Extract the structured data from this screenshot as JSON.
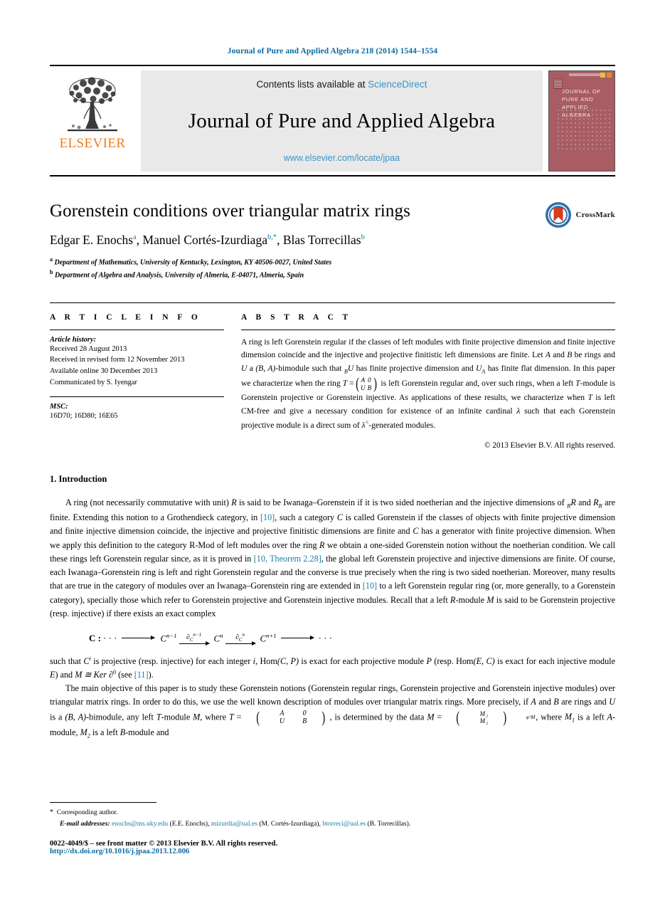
{
  "running_head": "Journal of Pure and Applied Algebra 218 (2014) 1544–1554",
  "masthead": {
    "publisher": "ELSEVIER",
    "contents_prefix": "Contents lists available at ",
    "contents_link": "ScienceDirect",
    "journal_title": "Journal of Pure and Applied Algebra",
    "journal_url": "www.elsevier.com/locate/jpaa",
    "cover_title": "JOURNAL OF PURE AND APPLIED ALGEBRA",
    "link_color": "#3c94c8",
    "cover_color": "#a95c63"
  },
  "article": {
    "title": "Gorenstein conditions over triangular matrix rings",
    "authors": [
      {
        "name": "Edgar E. Enochs",
        "marks": "a"
      },
      {
        "name": "Manuel Cortés-Izurdiaga",
        "marks": "b,*"
      },
      {
        "name": "Blas Torrecillas",
        "marks": "b"
      }
    ],
    "affiliations": [
      {
        "mark": "a",
        "text": "Department of Mathematics, University of Kentucky, Lexington, KY 40506-0027, United States"
      },
      {
        "mark": "b",
        "text": "Department of Algebra and Analysis, University of Almeria, E-04071, Almeria, Spain"
      }
    ],
    "crossmark_label": "CrossMark"
  },
  "info": {
    "heading": "A R T I C L E  I N F O",
    "history_title": "Article history:",
    "history": [
      "Received 28 August 2013",
      "Received in revised form 12 November 2013",
      "Available online 30 December 2013",
      "Communicated by S. Iyengar"
    ],
    "msc_title": "MSC:",
    "msc_codes": "16D70; 16D80; 16E65"
  },
  "abstract": {
    "heading": "A B S T R A C T",
    "p1": "A ring is left Gorenstein regular if the classes of left modules with finite projective dimension and finite injective dimension coincide and the injective and projective finitistic left dimensions are finite. Let ",
    "p2": " and ",
    "p3": " be rings and ",
    "p4": " a ",
    "p5": "-bimodule such that ",
    "p6": " has finite projective dimension and ",
    "p7": " has finite flat dimension. In this paper we characterize when the ring ",
    "p8": " is left Gorenstein regular and, over such rings, when a left ",
    "p9": "-module is Gorenstein projective or Gorenstein injective. As applications of these results, we characterize when ",
    "p10": " is left CM-free and give a necessary condition for existence of an infinite cardinal ",
    "p11": " such that each Gorenstein projective module is a direct sum of ",
    "p12": "-generated modules.",
    "var_A": "A",
    "var_B": "B",
    "var_U": "U",
    "bimod": "(B, A)",
    "sub_BU": "U",
    "sub_B": "B",
    "U_A": "U",
    "sub_A": "A",
    "var_T": "T",
    "lambda": "λ",
    "lambda_sup": "<",
    "matrix": {
      "r1c1": "A",
      "r1c2": "0",
      "r2c1": "U",
      "r2c2": "B"
    },
    "copyright": "© 2013 Elsevier B.V. All rights reserved."
  },
  "intro": {
    "heading": "1. Introduction",
    "para1_a": "A ring (not necessarily commutative with unit) ",
    "para1_b": " is said to be Iwanaga–Gorenstein if it is two sided noetherian and the injective dimensions of ",
    "para1_c": " and ",
    "para1_d": " are finite. Extending this notion to a Grothendieck category, in ",
    "ref10": "[10]",
    "para1_e": ", such a category ",
    "para1_f": " is called Gorenstein if the classes of objects with finite projective dimension and finite injective dimension coincide, the injective and projective finitistic dimensions are finite and ",
    "para1_g": " has a generator with finite projective dimension. When we apply this definition to the category R-Mod of left modules over the ring ",
    "para1_h": " we obtain a one-sided Gorenstein notion without the noetherian condition. We call these rings left Gorenstein regular since, as it is proved in ",
    "ref10thm": "[10, Theorem 2.28]",
    "para1_i": ", the global left Gorenstein projective and injective dimensions are finite. Of course, each Iwanaga–Gorenstein ring is left and right Gorenstein regular and the converse is true precisely when the ring is two sided noetherian. Moreover, many results that are true in the category of modules over an Iwanaga–Gorenstein ring are extended in ",
    "para1_j": " to a left Gorenstein regular ring (or, more generally, to a Gorenstein category), specially those which refer to Gorenstein projective and Gorenstein injective modules. Recall that a left ",
    "para1_k": "-module ",
    "para1_l": " is said to be Gorenstein projective (resp. injective) if there exists an exact complex",
    "var_R": "R",
    "var_C": "C",
    "var_M": "M",
    "sub_R": "R",
    "equation": {
      "label": "C :",
      "dots_left": "· · ·",
      "term1": "C",
      "term1_sup": "n−1",
      "map1": "∂",
      "map1_sub": "C",
      "map1_sup": "n−1",
      "term2": "C",
      "term2_sup": "n",
      "map2": "∂",
      "map2_sub": "C",
      "map2_sup": "n",
      "term3": "C",
      "term3_sup": "n+1",
      "dots_right": "· · ·"
    },
    "para2_a": "such that ",
    "para2_Ci": "C",
    "para2_Ci_sup": "i",
    "para2_b": " is projective (resp. injective) for each integer ",
    "para2_i": "i",
    "para2_c": ", Hom",
    "para2_homCP": "(C, P)",
    "para2_d": " is exact for each projective module ",
    "para2_P": "P",
    "para2_e": " (resp. Hom",
    "para2_homEC": "(E, C)",
    "para2_f": " is exact for each injective module ",
    "para2_E": "E",
    "para2_g": ") and ",
    "para2_M_iso": "M ≅ Ker ∂",
    "para2_sup0": "0",
    "para2_h": " (see ",
    "ref11": "[11]",
    "para2_i2": ").",
    "para3_a": "The main objective of this paper is to study these Gorenstein notions (Gorenstein regular rings, Gorenstein projective and Gorenstein injective modules) over triangular matrix rings. In order to do this, we use the well known description of modules over triangular matrix rings. More precisely, if ",
    "para3_A": "A",
    "para3_b": " and ",
    "para3_B": "B",
    "para3_c": " are rings and ",
    "para3_U": "U",
    "para3_d": " is a ",
    "para3_bimod": "(B, A)",
    "para3_e": "-bimodule, any left ",
    "para3_T": "T",
    "para3_f": "-module ",
    "para3_M": "M",
    "para3_g": ", where ",
    "para3_h": ", is determined by the data ",
    "para3_i": ", where ",
    "para3_M1": "M",
    "para3_M1_sub": "1",
    "para3_j": " is a left ",
    "para3_k": "-module, ",
    "para3_M2": "M",
    "para3_M2_sub": "2",
    "para3_l": " is a left ",
    "para3_m": "-module and",
    "matrixT": {
      "r1c1": "A",
      "r1c2": "0",
      "r2c1": "U",
      "r2c2": "B"
    },
    "matrixM": {
      "r1": "M₁",
      "r2": "M₂",
      "sub": "φ^M"
    }
  },
  "footer": {
    "corresponding_mark": "*",
    "corresponding_text": "Corresponding author.",
    "email_label": "E-mail addresses:",
    "emails": [
      {
        "addr": "enochs@ms.uky.edu",
        "who": "(E.E. Enochs)"
      },
      {
        "addr": "mizurdia@ual.es",
        "who": "(M. Cortés-Izurdiaga)"
      },
      {
        "addr": "btorreci@ual.es",
        "who": "(B. Torrecillas)"
      }
    ],
    "issn_line": "0022-4049/$ – see front matter  © 2013 Elsevier B.V. All rights reserved.",
    "doi": "http://dx.doi.org/10.1016/j.jpaa.2013.12.006",
    "link_color": "#0a6ba3"
  }
}
